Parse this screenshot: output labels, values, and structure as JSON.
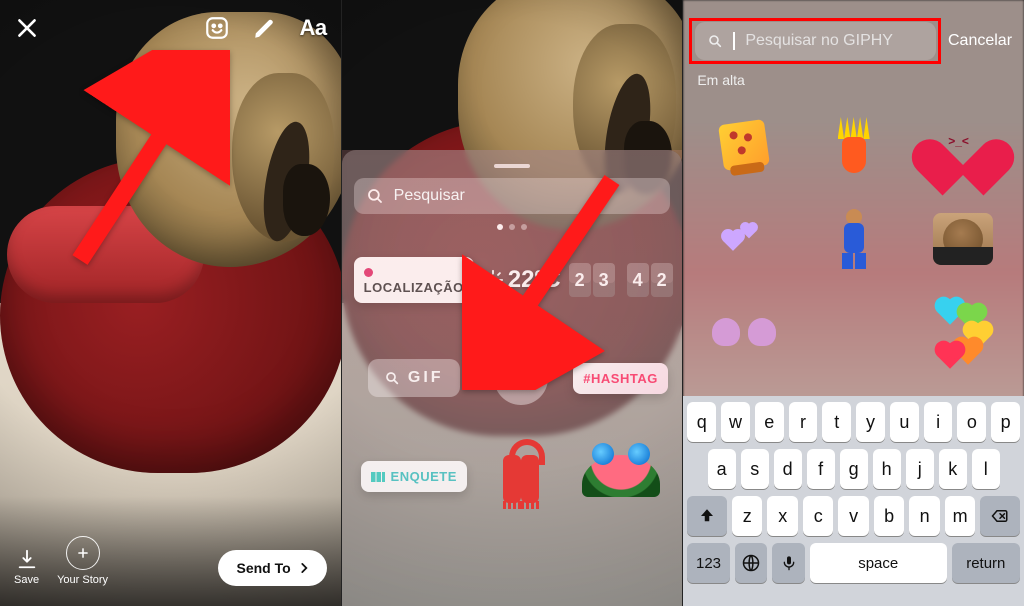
{
  "panel1": {
    "text_tool": "Aa",
    "save_label": "Save",
    "your_story_label": "Your Story",
    "send_to_label": "Send To"
  },
  "panel2": {
    "search_placeholder": "Pesquisar",
    "location_label": "LOCALIZAÇÃO",
    "temperature": "22ºC",
    "time_digits": [
      "2",
      "3",
      "4",
      "2"
    ],
    "gif_label": "GIF",
    "hashtag_label": "#HASHTAG",
    "poll_label": "ENQUETE"
  },
  "panel3": {
    "search_placeholder": "Pesquisar no GIPHY",
    "cancel_label": "Cancelar",
    "trending_label": "Em alta"
  },
  "keyboard": {
    "row1": [
      "q",
      "w",
      "e",
      "r",
      "t",
      "y",
      "u",
      "i",
      "o",
      "p"
    ],
    "row2": [
      "a",
      "s",
      "d",
      "f",
      "g",
      "h",
      "j",
      "k",
      "l"
    ],
    "row3": [
      "z",
      "x",
      "c",
      "v",
      "b",
      "n",
      "m"
    ],
    "num_label": "123",
    "space_label": "space",
    "return_label": "return"
  }
}
